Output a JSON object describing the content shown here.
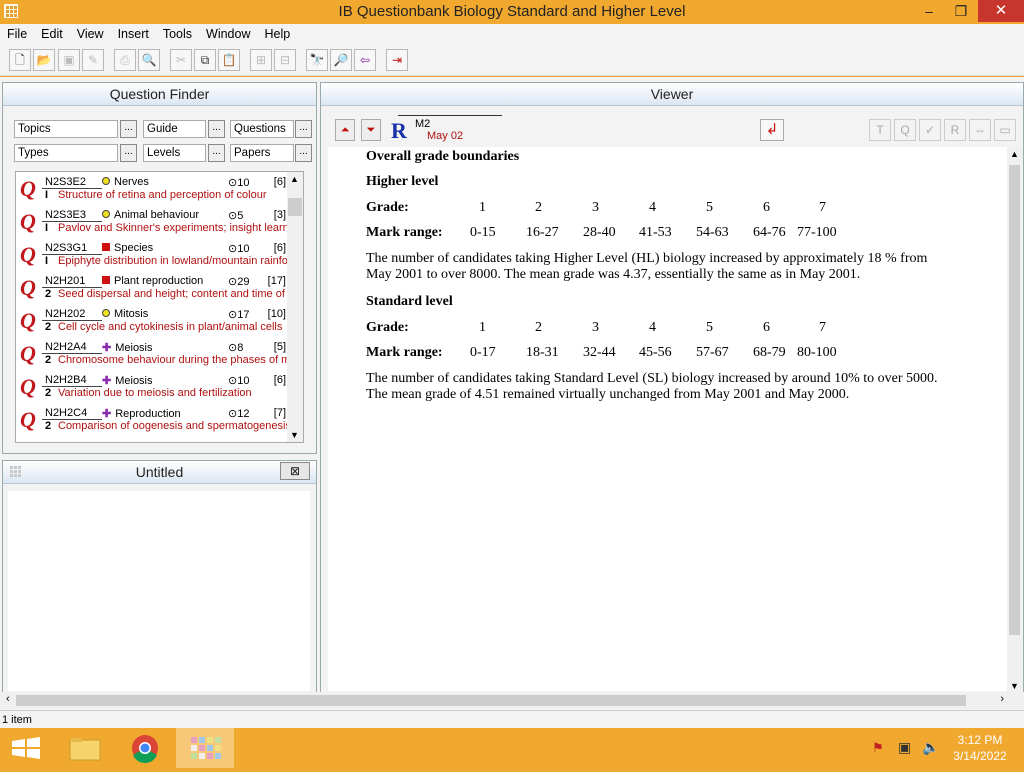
{
  "window": {
    "title": "IB Questionbank Biology Standard and Higher Level"
  },
  "menu": [
    "File",
    "Edit",
    "View",
    "Insert",
    "Tools",
    "Window",
    "Help"
  ],
  "question_finder": {
    "title": "Question Finder",
    "filters": [
      "Topics",
      "Guide",
      "Questions",
      "Types",
      "Levels",
      "Papers"
    ],
    "filter_button_label": "...",
    "items": [
      {
        "code": "N2S3E2",
        "marker": "#f0e020",
        "topic": "Nerves",
        "time": "⊙10",
        "marks": "[6]",
        "level": "I",
        "desc": "Structure of retina and perception of colour"
      },
      {
        "code": "N2S3E3",
        "marker": "#f0e020",
        "topic": "Animal behaviour",
        "time": "⊙5",
        "marks": "[3]",
        "level": "I",
        "desc": "Pavlov and Skinner's experiments; insight learning"
      },
      {
        "code": "N2S3G1",
        "marker": "#d01010",
        "topic": "Species",
        "time": "⊙10",
        "marks": "[6]",
        "level": "I",
        "desc": "Epiphyte distribution in lowland/mountain rainforest"
      },
      {
        "code": "N2H201",
        "marker": "#d01010",
        "topic": "Plant reproduction",
        "time": "⊙29",
        "marks": "[17]",
        "level": "2",
        "desc": "Seed dispersal and height; content and time of release"
      },
      {
        "code": "N2H202",
        "marker": "#f0e020",
        "topic": "Mitosis",
        "time": "⊙17",
        "marks": "[10]",
        "level": "2",
        "desc": "Cell cycle and cytokinesis in plant/animal cells"
      },
      {
        "code": "N2H2A4",
        "marker": "#8a2bb0",
        "topic": "Meiosis",
        "time": "⊙8",
        "marks": "[5]",
        "level": "2",
        "desc": "Chromosome behaviour during the phases of meiosis"
      },
      {
        "code": "N2H2B4",
        "marker": "#8a2bb0",
        "topic": "Meiosis",
        "time": "⊙10",
        "marks": "[6]",
        "level": "2",
        "desc": "Variation due to meiosis and fertilization"
      },
      {
        "code": "N2H2C4",
        "marker": "#8a2bb0",
        "topic": "Reproduction",
        "time": "⊙12",
        "marks": "[7]",
        "level": "2",
        "desc": "Comparison of oogenesis and spermatogenesis"
      }
    ]
  },
  "untitled": {
    "title": "Untitled",
    "close": "⊠"
  },
  "viewer": {
    "title": "Viewer",
    "paper_code": "M2",
    "paper_date": "May 02",
    "r_label": "R",
    "doc": {
      "heading": "Overall grade boundaries",
      "hl_heading": "Higher level",
      "grade_label": "Grade:",
      "range_label": "Mark range:",
      "grades": [
        "1",
        "2",
        "3",
        "4",
        "5",
        "6",
        "7"
      ],
      "hl_ranges": [
        "0-15",
        "16-27",
        "28-40",
        "41-53",
        "54-63",
        "64-76",
        "77-100"
      ],
      "hl_para": "The number of candidates taking Higher Level (HL) biology increased by approximately 18 % from May 2001 to over 8000. The mean grade was 4.37, essentially the same as in May 2001.",
      "sl_heading": "Standard level",
      "sl_ranges": [
        "0-17",
        "18-31",
        "32-44",
        "45-56",
        "57-67",
        "68-79",
        "80-100"
      ],
      "sl_para": "The number of candidates taking Standard Level (SL) biology increased by around 10% to over 5000. The mean grade of 4.51 remained virtually unchanged from May 2001 and May 2000."
    }
  },
  "status": {
    "text": "1 item"
  },
  "taskbar": {
    "time": "3:12 PM",
    "date": "3/14/2022"
  }
}
